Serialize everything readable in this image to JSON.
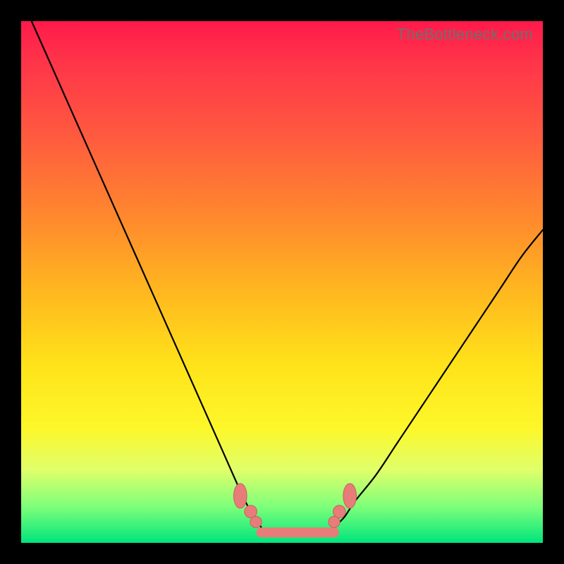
{
  "watermark": "TheBottleneck.com",
  "colors": {
    "frame": "#000000",
    "marker_fill": "#e77c78",
    "marker_stroke": "#c7625f",
    "curve": "#000000"
  },
  "chart_data": {
    "type": "line",
    "title": "",
    "xlabel": "",
    "ylabel": "",
    "xlim": [
      0,
      100
    ],
    "ylim": [
      0,
      100
    ],
    "grid": false,
    "legend": false,
    "series": [
      {
        "name": "left-curve",
        "x": [
          2,
          6,
          10,
          14,
          18,
          22,
          26,
          30,
          34,
          38,
          42,
          44,
          46
        ],
        "values": [
          100,
          91,
          82,
          73,
          64,
          55,
          46,
          37,
          28,
          19,
          10,
          6,
          3
        ]
      },
      {
        "name": "right-curve",
        "x": [
          60,
          62,
          64,
          68,
          72,
          76,
          80,
          84,
          88,
          92,
          96,
          100
        ],
        "values": [
          3,
          5,
          8,
          13,
          19,
          25,
          31,
          37,
          43,
          49,
          55,
          60
        ]
      },
      {
        "name": "flat-minimum",
        "x": [
          46,
          50,
          54,
          58,
          60
        ],
        "values": [
          2,
          2,
          2,
          2,
          2
        ]
      }
    ],
    "markers": [
      {
        "x": 42,
        "y": 9,
        "r": 1.4,
        "shape": "ellipse-v"
      },
      {
        "x": 44,
        "y": 6,
        "r": 1.2,
        "shape": "circle"
      },
      {
        "x": 45,
        "y": 4,
        "r": 1.1,
        "shape": "circle"
      },
      {
        "x": 60,
        "y": 4,
        "r": 1.1,
        "shape": "circle"
      },
      {
        "x": 61,
        "y": 6,
        "r": 1.2,
        "shape": "circle"
      },
      {
        "x": 63,
        "y": 9,
        "r": 1.4,
        "shape": "ellipse-v"
      }
    ],
    "annotations": []
  }
}
